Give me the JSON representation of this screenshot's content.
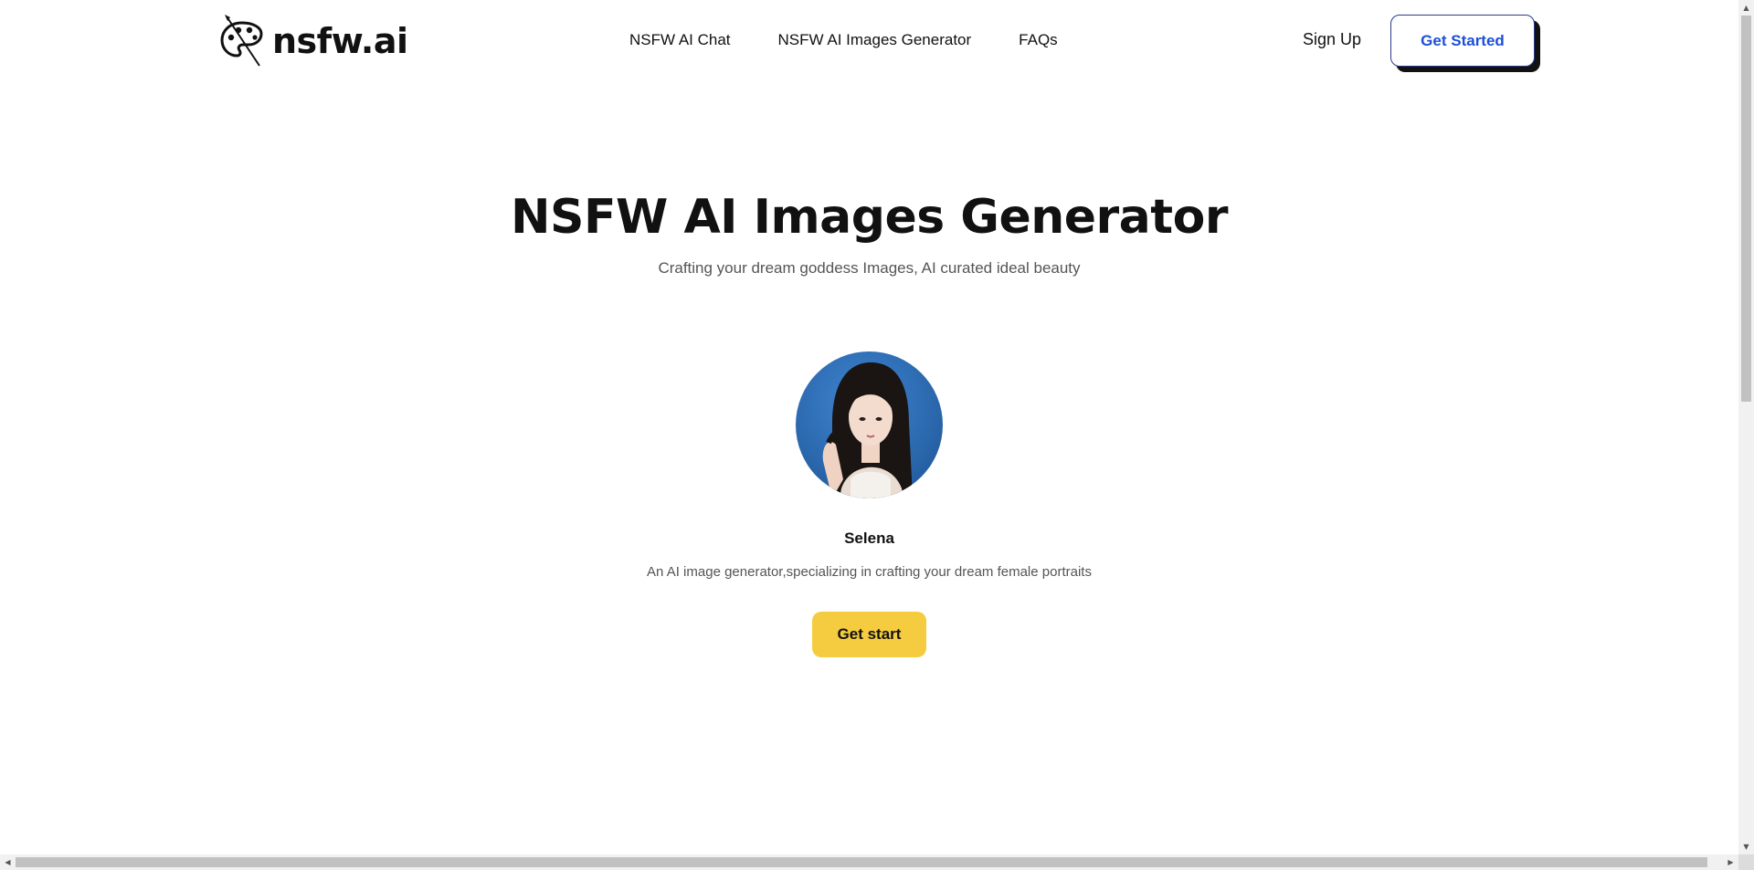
{
  "header": {
    "logo_text": "nsfw.ai",
    "logo_icon": "palette-brush-icon",
    "nav": [
      {
        "label": "NSFW AI Chat"
      },
      {
        "label": "NSFW AI Images Generator"
      },
      {
        "label": "FAQs"
      }
    ],
    "signup_label": "Sign Up",
    "get_started_label": "Get Started"
  },
  "hero": {
    "title": "NSFW AI Images Generator",
    "subtitle": "Crafting your dream goddess Images, AI curated ideal beauty"
  },
  "profile": {
    "name": "Selena",
    "description": "An AI image generator,specializing in crafting your dream female portraits",
    "cta_label": "Get start"
  },
  "colors": {
    "cta_yellow": "#f5cc3f",
    "link_blue": "#1c4fd8",
    "avatar_background_blue": "#2f6db5"
  },
  "scrollbars": {
    "vertical_icons": [
      "arrow-up-icon",
      "arrow-down-icon"
    ],
    "horizontal_icons": [
      "arrow-left-icon",
      "arrow-right-icon"
    ]
  }
}
